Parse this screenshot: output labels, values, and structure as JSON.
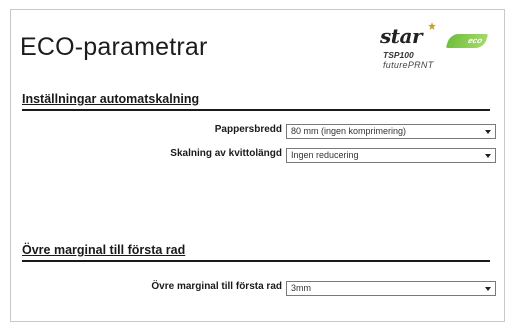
{
  "page": {
    "title": "ECO-parametrar"
  },
  "logo": {
    "brand": "star",
    "badge": "eco",
    "model": "TSP100",
    "product_line": "futurePRNT",
    "icon": "star-logo-icon"
  },
  "section_scaling": {
    "heading": "Inställningar automatskalning",
    "fields": {
      "paper_width": {
        "label": "Pappersbredd",
        "value": "80 mm (ingen komprimering)"
      },
      "receipt_length": {
        "label": "Skalning av kvittolängd",
        "value": "Ingen reducering"
      }
    }
  },
  "section_margin": {
    "heading": "Övre marginal till första rad",
    "fields": {
      "top_margin": {
        "label": "Övre marginal till första rad",
        "value": "3mm"
      }
    }
  },
  "colors": {
    "accent_eco": "#6fbf3c",
    "text": "#1a1a1a",
    "border": "#7a7a7a"
  }
}
